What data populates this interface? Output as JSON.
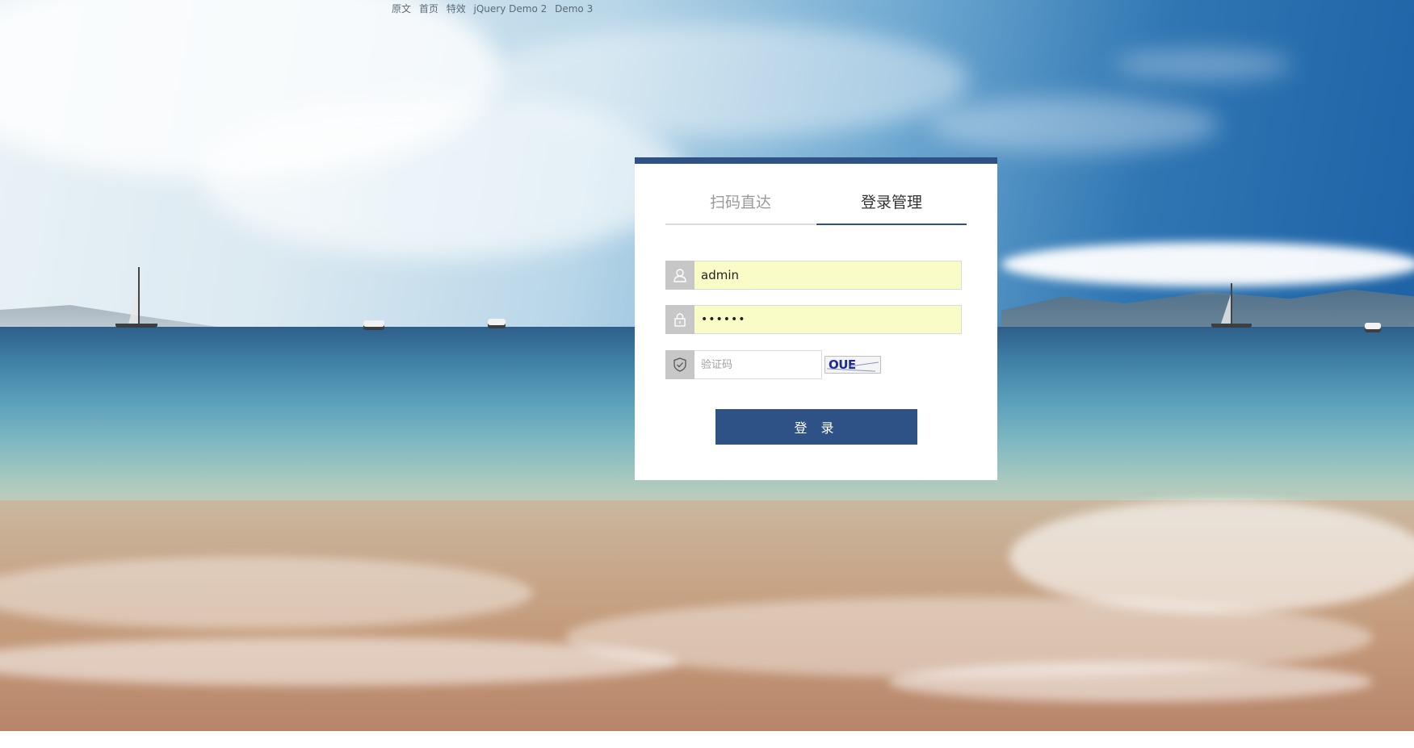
{
  "top_links": [
    "原文",
    "首页",
    "特效",
    "jQuery Demo 2",
    "Demo 3"
  ],
  "tabs": [
    {
      "label": "扫码直达",
      "active": false
    },
    {
      "label": "登录管理",
      "active": true
    }
  ],
  "form": {
    "username_value": "admin",
    "password_value": "••••••",
    "captcha_placeholder": "验证码",
    "captcha_text": "OUE",
    "submit_label": "登 录"
  },
  "icons": {
    "user": "user-icon",
    "lock": "lock-icon",
    "shield": "shield-check-icon"
  },
  "colors": {
    "accent": "#2e5286",
    "autofill_bg": "#fafcc8",
    "icon_box": "#c7c7c7",
    "inactive_tab_text": "#9a9a9a"
  }
}
